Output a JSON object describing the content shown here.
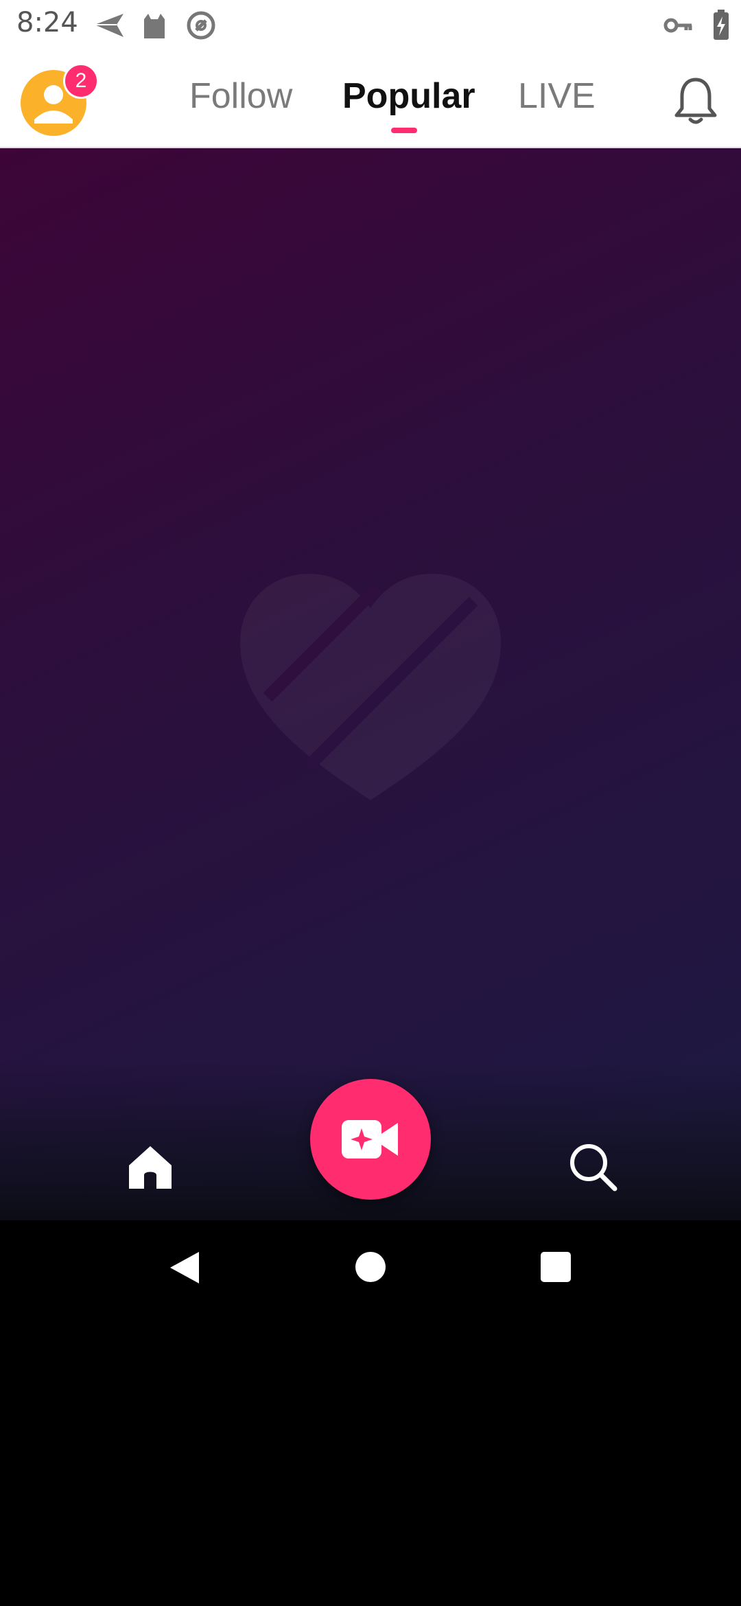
{
  "status_bar": {
    "time": "8:24",
    "icons": [
      "send-icon",
      "cat-icon",
      "at-sign-icon",
      "key-icon",
      "battery-charging-icon"
    ]
  },
  "header": {
    "notification_count": "2",
    "tabs": [
      {
        "label": "Follow",
        "active": false
      },
      {
        "label": "Popular",
        "active": true
      },
      {
        "label": "LIVE",
        "active": false
      }
    ],
    "right_icon": "bell-icon"
  },
  "bottom_nav": {
    "items": [
      "home-icon",
      "video-record-icon",
      "search-icon"
    ]
  },
  "system_nav": {
    "items": [
      "back-icon",
      "home-circle-icon",
      "recents-square-icon"
    ]
  },
  "colors": {
    "accent": "#ff2d6f",
    "avatar_bg": "#fbb22a",
    "content_gradient_start": "#3d0538",
    "content_gradient_end": "#1c1a42"
  }
}
